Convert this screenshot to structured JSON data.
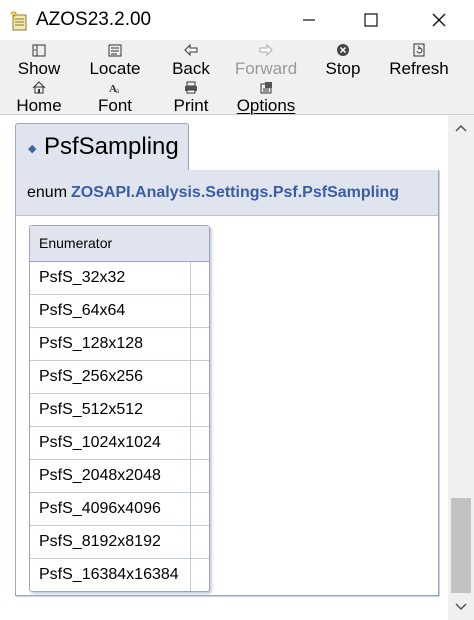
{
  "window": {
    "title": "AZOS23.2.00",
    "minimize": "—",
    "maximize": "☐",
    "close": "✕"
  },
  "toolbar": {
    "buttons": [
      {
        "label": "Show",
        "icon": "show-icon",
        "enabled": true
      },
      {
        "label": "Locate",
        "icon": "locate-icon",
        "enabled": true
      },
      {
        "label": "Back",
        "icon": "back-arrow-icon",
        "enabled": true
      },
      {
        "label": "Forward",
        "icon": "forward-arrow-icon",
        "enabled": false
      },
      {
        "label": "Stop",
        "icon": "stop-icon",
        "enabled": true
      },
      {
        "label": "Refresh",
        "icon": "refresh-icon",
        "enabled": true
      },
      {
        "label": "Home",
        "icon": "home-icon",
        "enabled": true
      },
      {
        "label": "Font",
        "icon": "font-icon",
        "enabled": true
      },
      {
        "label": "Print",
        "icon": "print-icon",
        "enabled": true
      },
      {
        "label": "Options",
        "icon": "options-icon",
        "enabled": true
      }
    ]
  },
  "page": {
    "tab_title": "PsfSampling",
    "enum_keyword": "enum",
    "enum_type": "ZOSAPI.Analysis.Settings.Psf.PsfSampling",
    "table_header": "Enumerator",
    "enumerators": [
      "PsfS_32x32",
      "PsfS_64x64",
      "PsfS_128x128",
      "PsfS_256x256",
      "PsfS_512x512",
      "PsfS_1024x1024",
      "PsfS_2048x2048",
      "PsfS_4096x4096",
      "PsfS_8192x8192",
      "PsfS_16384x16384"
    ]
  },
  "colors": {
    "accent": "#3a5ea0",
    "header_bg": "#dfe4ef",
    "toolbar_bg": "#f0f0f0"
  }
}
